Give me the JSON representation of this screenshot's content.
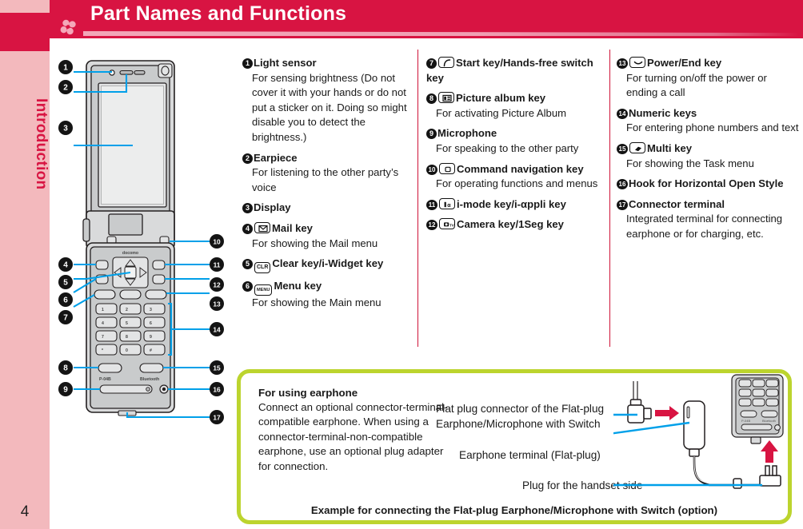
{
  "header": {
    "title": "Part Names and Functions",
    "flower_icon": "clover-flower-icon",
    "bar_color": "#d81442",
    "accent_color": "#cf1338"
  },
  "sidebar": {
    "label": "Introduction",
    "page_number": "4",
    "background": "#f3b9bd",
    "tab_color": "#d81442"
  },
  "diagram": {
    "name": "mobile-phone-front-view",
    "brand_text": "docomo",
    "model_text": "P-04B",
    "bluetooth_text": "Bluetooth",
    "callouts": [
      "1",
      "2",
      "3",
      "4",
      "5",
      "6",
      "7",
      "8",
      "9",
      "10",
      "11",
      "12",
      "13",
      "14",
      "15",
      "16",
      "17"
    ],
    "keypad_labels": [
      "1",
      "2",
      "3",
      "4",
      "5",
      "6",
      "7",
      "8",
      "9",
      "*",
      "0",
      "#"
    ]
  },
  "columns": {
    "col1": [
      {
        "num": "1",
        "icon": "",
        "title": "Light sensor",
        "desc": "For sensing brightness (Do not cover it with your hands or do not put a sticker on it. Doing so might disable you to detect the brightness.)"
      },
      {
        "num": "2",
        "icon": "",
        "title": "Earpiece",
        "desc": "For listening to the other party’s voice"
      },
      {
        "num": "3",
        "icon": "",
        "title": "Display",
        "desc": ""
      },
      {
        "num": "4",
        "icon": "mail-envelope-key-icon",
        "title": "Mail key",
        "desc": "For showing the Mail menu"
      },
      {
        "num": "5",
        "icon": "clr-key-icon",
        "icon_text": "CLR",
        "title": "Clear key/i-Widget key",
        "desc": ""
      },
      {
        "num": "6",
        "icon": "menu-key-icon",
        "icon_text": "MENU",
        "title": "Menu key",
        "desc": "For showing the Main menu"
      }
    ],
    "col2": [
      {
        "num": "7",
        "icon": "start-handsfree-key-icon",
        "title": "Start key/Hands-free switch key",
        "desc": ""
      },
      {
        "num": "8",
        "icon": "picture-album-key-icon",
        "title": "Picture album key",
        "desc": "For activating Picture Album"
      },
      {
        "num": "9",
        "icon": "",
        "title": "Microphone",
        "desc": "For speaking to the other party"
      },
      {
        "num": "10",
        "icon": "command-navigation-key-icon",
        "title": "Command navigation key",
        "desc": "For operating functions and menus"
      },
      {
        "num": "11",
        "icon": "i-mode-key-icon",
        "title": "i-mode key/i-αppli key",
        "desc": ""
      },
      {
        "num": "12",
        "icon": "camera-1seg-key-icon",
        "title": "Camera key/1Seg key",
        "desc": ""
      }
    ],
    "col3": [
      {
        "num": "13",
        "icon": "power-end-key-icon",
        "title": "Power/End key",
        "desc": "For turning on/off the power or ending a call"
      },
      {
        "num": "14",
        "icon": "",
        "title": "Numeric keys",
        "desc": "For entering phone numbers and text"
      },
      {
        "num": "15",
        "icon": "multi-key-icon",
        "title": "Multi key",
        "desc": "For showing the Task menu"
      },
      {
        "num": "16",
        "icon": "",
        "title": "Hook for Horizontal Open Style",
        "desc": ""
      },
      {
        "num": "17",
        "icon": "",
        "title": "Connector terminal",
        "desc": "Integrated terminal for connecting earphone or for charging, etc."
      }
    ]
  },
  "earphone_box": {
    "border_color": "#bcd42e",
    "heading": "For using earphone",
    "body": "Connect an optional connector-terminal-compatible earphone. When using a connector-terminal-non-compatible earphone, use an optional plug adapter for connection.",
    "caption_flat_plug": "Flat plug connector of the Flat-plug Earphone/Microphone with Switch",
    "caption_earphone_terminal": "Earphone terminal (Flat-plug)",
    "caption_handset_plug": "Plug for the handset side",
    "footer": "Example for connecting the Flat-plug Earphone/Microphone with Switch (option)",
    "art_name": "flat-plug-earphone-connection-illustration"
  }
}
